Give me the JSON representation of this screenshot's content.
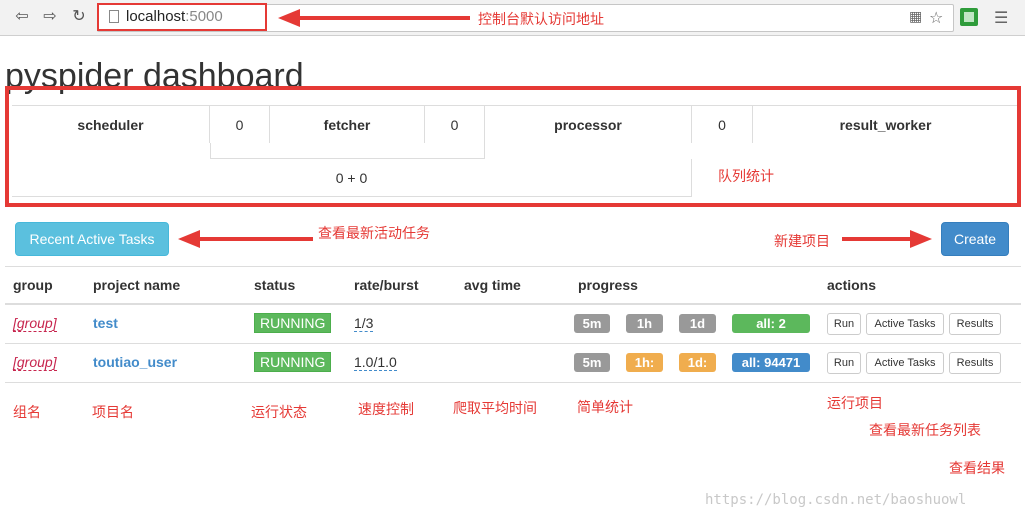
{
  "browser": {
    "url_host": "localhost",
    "url_port": ":5000"
  },
  "page": {
    "title": "pyspider dashboard"
  },
  "queues": {
    "scheduler_label": "scheduler",
    "scheduler_value": "0",
    "fetcher_label": "fetcher",
    "fetcher_value": "0",
    "processor_label": "processor",
    "processor_value": "0",
    "result_worker_label": "result_worker",
    "sum": "0 + 0"
  },
  "buttons": {
    "recent_active_tasks": "Recent Active Tasks",
    "create": "Create"
  },
  "table": {
    "headers": [
      "group",
      "project name",
      "status",
      "rate/burst",
      "avg time",
      "progress",
      "actions"
    ],
    "rows": [
      {
        "group": "[group]",
        "name": "test",
        "status": "RUNNING",
        "rate": "1/3",
        "progress": {
          "m5": "5m",
          "h1": "1h",
          "d1": "1d",
          "all": "all: 2"
        },
        "progress_colors": {
          "m5": "#999999",
          "h1": "#999999",
          "d1": "#999999",
          "all": "#5cb85c"
        },
        "actions": [
          "Run",
          "Active Tasks",
          "Results"
        ]
      },
      {
        "group": "[group]",
        "name": "toutiao_user",
        "status": "RUNNING",
        "rate": "1.0/1.0",
        "progress": {
          "m5": "5m",
          "h1": "1h:",
          "d1": "1d:",
          "all": "all: 94471"
        },
        "progress_colors": {
          "m5": "#999999",
          "h1": "#f0ad4e",
          "d1": "#f0ad4e",
          "all": "#428bca"
        },
        "actions": [
          "Run",
          "Active Tasks",
          "Results"
        ]
      }
    ]
  },
  "annotations": {
    "url": "控制台默认访问地址",
    "queue": "队列统计",
    "recent": "查看最新活动任务",
    "create": "新建项目",
    "group": "组名",
    "project_name": "项目名",
    "status": "运行状态",
    "rate": "速度控制",
    "avg_time": "爬取平均时间",
    "progress": "简单统计",
    "run": "运行项目",
    "active_tasks": "查看最新任务列表",
    "results": "查看结果"
  },
  "watermark": "https://blog.csdn.net/baoshuowl",
  "colors": {
    "annotation": "#e53935",
    "link": "#428bca",
    "running": "#5cb85c"
  }
}
